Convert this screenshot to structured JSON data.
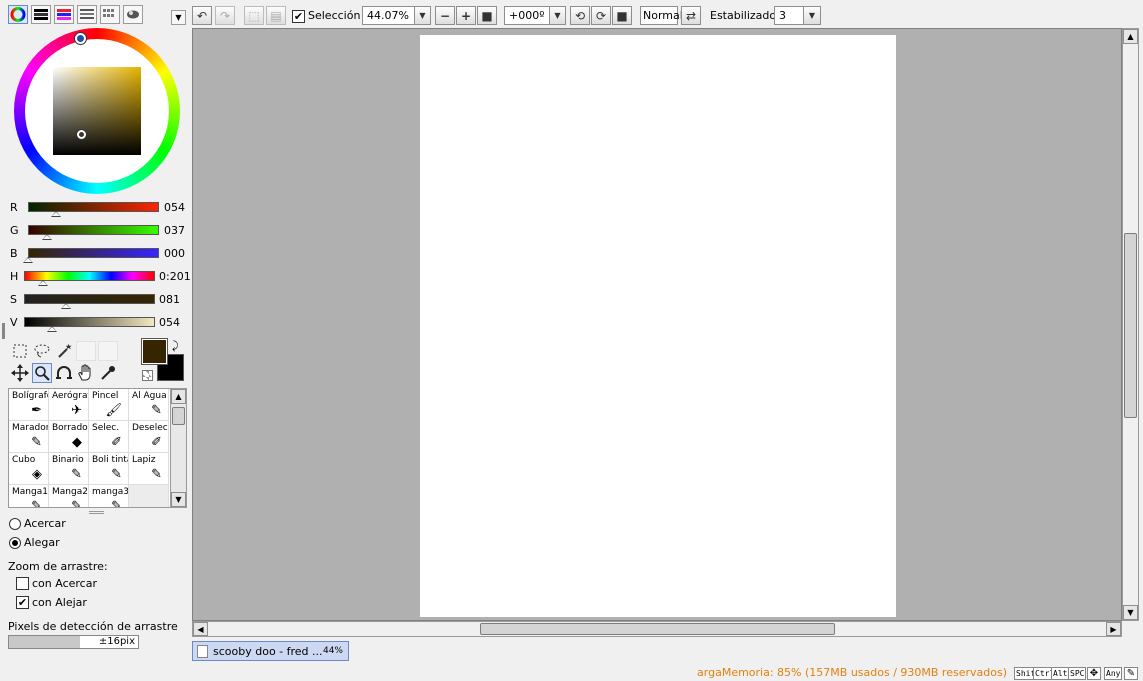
{
  "colors": {
    "r": 54,
    "g": 37,
    "b": 0,
    "primary": "#362500",
    "secondary": "#000000",
    "accent": "#6a89c8",
    "status": "#e08010"
  },
  "sliders": [
    {
      "label": "R",
      "value": "054",
      "fraction": 0.212
    },
    {
      "label": "G",
      "value": "037",
      "fraction": 0.145
    },
    {
      "label": "B",
      "value": "000",
      "fraction": 0.0
    },
    {
      "label": "H",
      "value": "0:201",
      "fraction": 0.143
    },
    {
      "label": "S",
      "value": "081",
      "fraction": 0.318
    },
    {
      "label": "V",
      "value": "054",
      "fraction": 0.212
    }
  ],
  "selection_tools": [
    "rect-select-icon",
    "lasso-icon",
    "magic-wand-icon",
    "move-icon",
    "zoom-icon",
    "rotate-icon",
    "hand-icon",
    "eyedropper-icon"
  ],
  "brushes": [
    {
      "name": "Bolígrafo",
      "icon": "pen-icon"
    },
    {
      "name": "Aerógrafo",
      "icon": "airbrush-icon"
    },
    {
      "name": "Pincel",
      "icon": "brush-icon"
    },
    {
      "name": "Al Agua",
      "icon": "water-icon"
    },
    {
      "name": "Marador",
      "icon": "marker-icon"
    },
    {
      "name": "Borrador",
      "icon": "eraser-icon"
    },
    {
      "name": "Selec.",
      "icon": "select-brush-icon"
    },
    {
      "name": "Deselec.",
      "icon": "deselect-brush-icon"
    },
    {
      "name": "Cubo",
      "icon": "bucket-icon"
    },
    {
      "name": "Binario",
      "icon": "binary-pen-icon"
    },
    {
      "name": "Boli tinta",
      "icon": "ink-pen-icon"
    },
    {
      "name": "Lapiz",
      "icon": "pencil-icon"
    },
    {
      "name": "Manga1",
      "icon": "manga-pen-icon"
    },
    {
      "name": "Manga2",
      "icon": "manga-pen-icon"
    },
    {
      "name": "manga3",
      "icon": "manga-pen-icon"
    },
    {
      "name": "",
      "icon": ""
    }
  ],
  "zoom_options": {
    "acercar": "Acercar",
    "alegar": "Alegar",
    "selected": "alegar",
    "drag_zoom_title": "Zoom de arrastre:",
    "con_acercar": "con Acercar",
    "con_acercar_checked": false,
    "con_alejar": "con Alejar",
    "con_alejar_checked": true,
    "pixel_detect_label": "Pixels de detección de arrastre",
    "pixel_detect_value": "±16pix",
    "pixel_detect_fraction": 0.55
  },
  "toolbar": {
    "seleccion_label": "Selección",
    "seleccion_checked": true,
    "zoom": "44.07%",
    "rotation": "+000º",
    "blend_mode": "Normal",
    "stabilizer_label": "Estabilizador",
    "stabilizer_value": "3"
  },
  "document_tab": {
    "name": "scooby doo - fred ...",
    "zoom": "44%"
  },
  "status": {
    "memory": "argaMemoria: 85% (157MB usados / 930MB reservados)",
    "keys": [
      "Shift",
      "Ctrl",
      "Alt",
      "SPC",
      "Any"
    ]
  }
}
